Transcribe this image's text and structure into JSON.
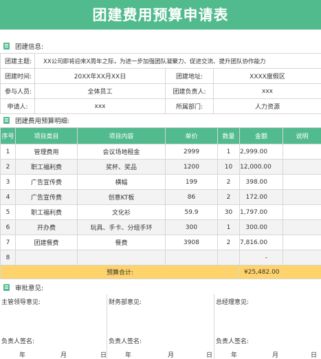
{
  "title": "团建费用预算申请表",
  "team_info": {
    "section_title": "团建信息:",
    "theme_label": "团建主题:",
    "theme_value": "XX公司即将迎来X周年之际，为进一步加强团队凝聚力、促进交流、提升团队协作能力",
    "time_label": "团建时间:",
    "time_value": "20XX年XX月XX日",
    "place_label": "团建地址:",
    "place_value": "XXXX度假区",
    "participants_label": "参与人员:",
    "participants_value": "全体员工",
    "leader_label": "团建负责人:",
    "leader_value": "xxx",
    "applicant_label": "申请人:",
    "applicant_value": "xxx",
    "dept_label": "所属部门:",
    "dept_value": "人力资源"
  },
  "budget": {
    "section_title": "团建费用预算明细:",
    "headers": [
      "序号",
      "项目类目",
      "项目内容",
      "单价",
      "数量",
      "金额",
      "说明"
    ],
    "rows": [
      {
        "no": "1",
        "category": "管理费用",
        "content": "会议场地租金",
        "price": "2999",
        "qty": "1",
        "amount": "2,999.00",
        "note": ""
      },
      {
        "no": "2",
        "category": "职工福利费",
        "content": "奖杯、奖品",
        "price": "1200",
        "qty": "10",
        "amount": "12,000.00",
        "note": ""
      },
      {
        "no": "3",
        "category": "广告宣传费",
        "content": "横幅",
        "price": "199",
        "qty": "2",
        "amount": "398.00",
        "note": ""
      },
      {
        "no": "4",
        "category": "广告宣传费",
        "content": "创意KT板",
        "price": "86",
        "qty": "2",
        "amount": "172.00",
        "note": ""
      },
      {
        "no": "5",
        "category": "职工福利费",
        "content": "文化衫",
        "price": "59.9",
        "qty": "30",
        "amount": "1,797.00",
        "note": ""
      },
      {
        "no": "6",
        "category": "开办费",
        "content": "玩具、手卡、分组手环",
        "price": "300",
        "qty": "1",
        "amount": "300.00",
        "note": ""
      },
      {
        "no": "7",
        "category": "团建餐费",
        "content": "餐费",
        "price": "3908",
        "qty": "2",
        "amount": "7,816.00",
        "note": ""
      },
      {
        "no": "8",
        "category": "",
        "content": "",
        "price": "",
        "qty": "",
        "amount": "-",
        "note": ""
      }
    ],
    "total_label": "预算合计:",
    "total_value": "¥25,482.00"
  },
  "approval": {
    "section_title": "审批意见:",
    "columns": [
      {
        "head": "主管领导意见:",
        "sign": "负责人签名:"
      },
      {
        "head": "财务部意见:",
        "sign": "负责人签名:"
      },
      {
        "head": "总经理意见:",
        "sign": "负责人签名:"
      }
    ],
    "year": "年",
    "month": "月",
    "day": "日"
  },
  "colors": {
    "accent": "#52bb8e",
    "total_row": "#ffd36b",
    "stripe": "#f3f3f3",
    "border": "#d6d6d6"
  }
}
